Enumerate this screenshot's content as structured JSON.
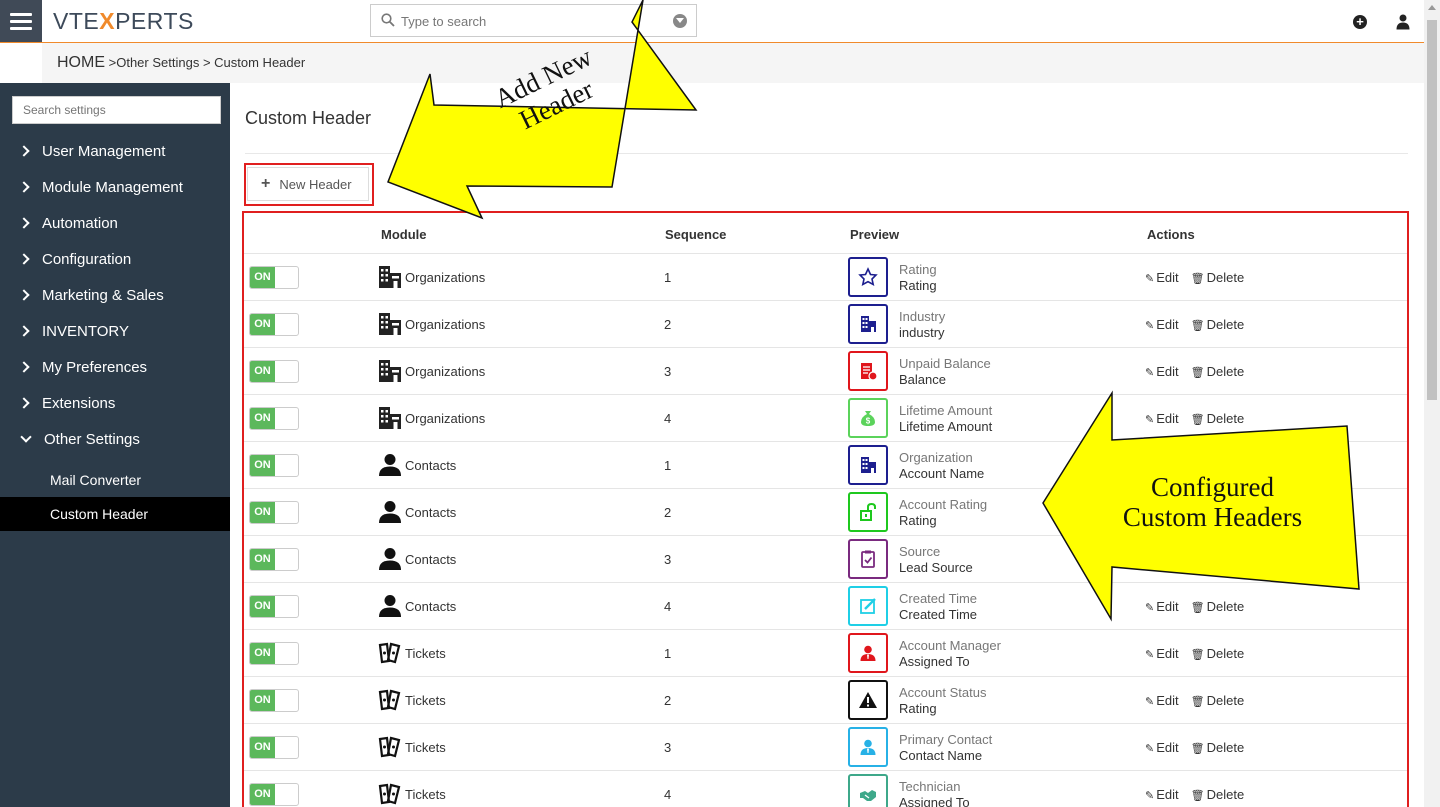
{
  "app": {
    "logo_left": "VTE",
    "logo_x": "X",
    "logo_right": "PERTS",
    "search_placeholder": "Type to search"
  },
  "breadcrumb": {
    "home": "HOME",
    "sep1": " >",
    "level1": "Other Settings",
    "sep2": " > ",
    "level2": "Custom Header"
  },
  "sidebar": {
    "search_placeholder": "Search settings",
    "items": [
      {
        "label": "User Management"
      },
      {
        "label": "Module Management"
      },
      {
        "label": "Automation"
      },
      {
        "label": "Configuration"
      },
      {
        "label": "Marketing & Sales"
      },
      {
        "label": "INVENTORY"
      },
      {
        "label": "My Preferences"
      },
      {
        "label": "Extensions"
      },
      {
        "label": "Other Settings"
      }
    ],
    "sub_items": [
      {
        "label": "Mail Converter"
      },
      {
        "label": "Custom Header"
      }
    ]
  },
  "main": {
    "title": "Custom Header",
    "new_button": "New Header",
    "columns": [
      "Module",
      "Sequence",
      "Preview",
      "Actions"
    ],
    "toggle_on": "ON",
    "edit_label": "Edit",
    "delete_label": "Delete",
    "rows": [
      {
        "module": "Organizations",
        "module_icon": "building-icon",
        "sequence": "1",
        "preview_label": "Rating",
        "preview_value": "Rating",
        "preview_icon": "star-icon",
        "color": "#1d1f8f"
      },
      {
        "module": "Organizations",
        "module_icon": "building-icon",
        "sequence": "2",
        "preview_label": "Industry",
        "preview_value": "industry",
        "preview_icon": "building-icon",
        "color": "#1d1f8f"
      },
      {
        "module": "Organizations",
        "module_icon": "building-icon",
        "sequence": "3",
        "preview_label": "Unpaid Balance",
        "preview_value": "Balance",
        "preview_icon": "invoice-icon",
        "color": "#e0161c"
      },
      {
        "module": "Organizations",
        "module_icon": "building-icon",
        "sequence": "4",
        "preview_label": "Lifetime Amount",
        "preview_value": "Lifetime Amount",
        "preview_icon": "money-bag-icon",
        "color": "#5bd35b"
      },
      {
        "module": "Contacts",
        "module_icon": "person-icon",
        "sequence": "1",
        "preview_label": "Organization",
        "preview_value": "Account Name",
        "preview_icon": "building-icon",
        "color": "#1d1f8f"
      },
      {
        "module": "Contacts",
        "module_icon": "person-icon",
        "sequence": "2",
        "preview_label": "Account Rating",
        "preview_value": "Rating",
        "preview_icon": "unlock-icon",
        "color": "#1ec81e"
      },
      {
        "module": "Contacts",
        "module_icon": "person-icon",
        "sequence": "3",
        "preview_label": "Source",
        "preview_value": "Lead Source",
        "preview_icon": "clipboard-icon",
        "color": "#7a2a7f"
      },
      {
        "module": "Contacts",
        "module_icon": "person-icon",
        "sequence": "4",
        "preview_label": "Created Time",
        "preview_value": "Created Time",
        "preview_icon": "edit-icon",
        "color": "#1fcfe6"
      },
      {
        "module": "Tickets",
        "module_icon": "ticket-icon",
        "sequence": "1",
        "preview_label": "Account Manager",
        "preview_value": "Assigned To",
        "preview_icon": "user-icon",
        "color": "#e0161c"
      },
      {
        "module": "Tickets",
        "module_icon": "ticket-icon",
        "sequence": "2",
        "preview_label": "Account Status",
        "preview_value": "Rating",
        "preview_icon": "warning-icon",
        "color": "#111111"
      },
      {
        "module": "Tickets",
        "module_icon": "ticket-icon",
        "sequence": "3",
        "preview_label": "Primary Contact",
        "preview_value": "Contact Name",
        "preview_icon": "user-icon",
        "color": "#27b1e6"
      },
      {
        "module": "Tickets",
        "module_icon": "ticket-icon",
        "sequence": "4",
        "preview_label": "Technician",
        "preview_value": "Assigned To",
        "preview_icon": "handshake-icon",
        "color": "#3ea88a"
      }
    ]
  },
  "callouts": {
    "add_new_line1": "Add New",
    "add_new_line2": "Header",
    "configured_line1": "Configured",
    "configured_line2": "Custom Headers"
  },
  "colors": {
    "accent": "#f08a2b",
    "sidebar_bg": "#2c3b49",
    "highlight_frame": "#e01f1f",
    "toggle_on": "#5cb85c",
    "callout_fill": "#ffff00"
  }
}
